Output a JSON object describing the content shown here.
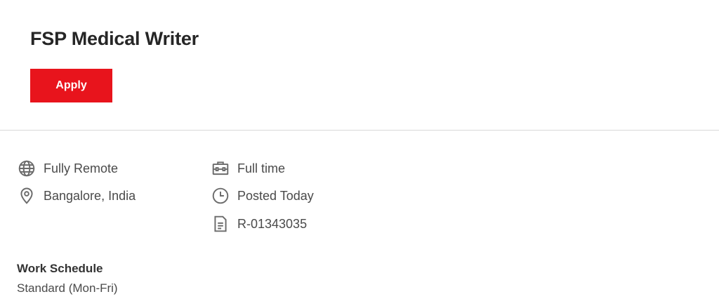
{
  "job": {
    "title": "FSP Medical Writer",
    "apply_label": "Apply"
  },
  "details": {
    "location_type": "Fully Remote",
    "location": "Bangalore, India",
    "employment_type": "Full time",
    "posted": "Posted Today",
    "requisition_id": "R-01343035"
  },
  "icons": {
    "location_type": "globe-icon",
    "location": "map-pin-icon",
    "employment_type": "briefcase-icon",
    "posted": "clock-icon",
    "requisition_id": "document-icon"
  },
  "schedule": {
    "label": "Work Schedule",
    "value": "Standard (Mon-Fri)"
  },
  "colors": {
    "accent": "#e8141c",
    "icon": "#6b6b6b",
    "divider": "#d8d8d8"
  }
}
